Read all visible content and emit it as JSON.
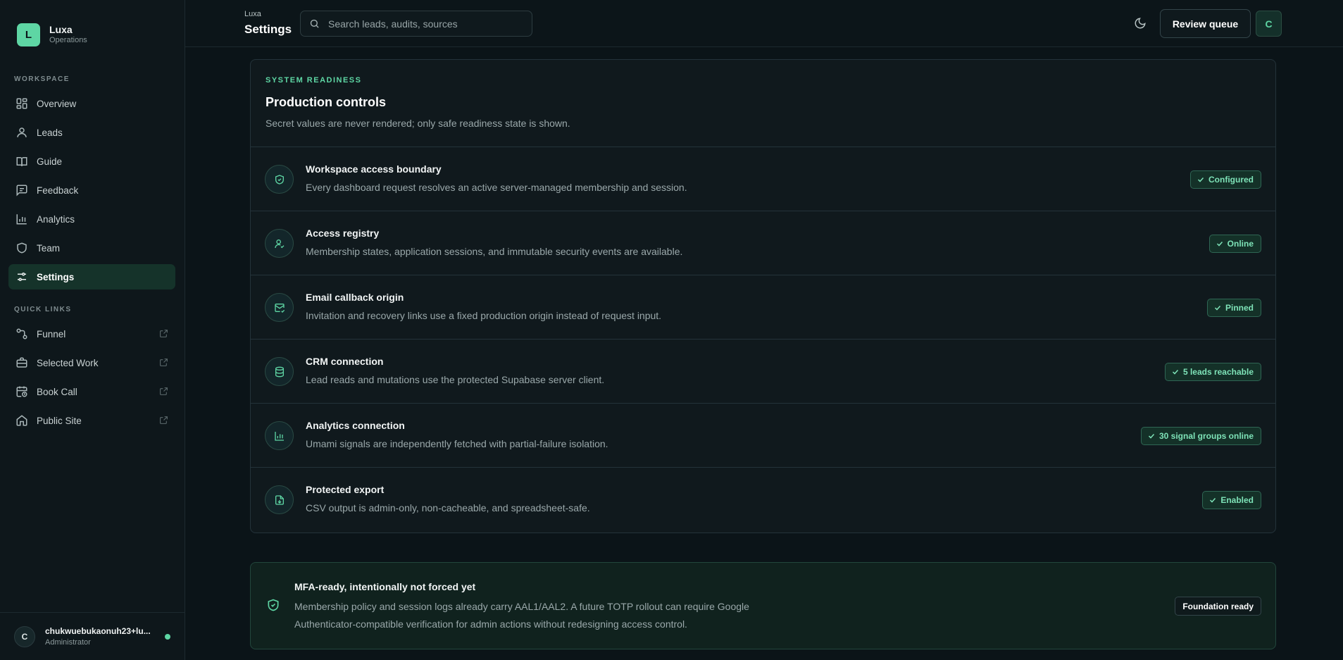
{
  "brand": {
    "logo_letter": "L",
    "name": "Luxa",
    "subtitle": "Operations"
  },
  "sidebar": {
    "workspace_label": "WORKSPACE",
    "workspace_items": [
      {
        "label": "Overview",
        "icon": "grid-icon"
      },
      {
        "label": "Leads",
        "icon": "user-icon"
      },
      {
        "label": "Guide",
        "icon": "book-open-icon"
      },
      {
        "label": "Feedback",
        "icon": "message-square-icon"
      },
      {
        "label": "Analytics",
        "icon": "bar-chart-icon"
      },
      {
        "label": "Team",
        "icon": "shield-icon"
      },
      {
        "label": "Settings",
        "icon": "sliders-icon",
        "active": true
      }
    ],
    "quick_links_label": "QUICK LINKS",
    "quick_links": [
      {
        "label": "Funnel",
        "icon": "funnel-icon"
      },
      {
        "label": "Selected Work",
        "icon": "briefcase-icon"
      },
      {
        "label": "Book Call",
        "icon": "calendar-clock-icon"
      },
      {
        "label": "Public Site",
        "icon": "home-icon"
      }
    ],
    "user": {
      "avatar_letter": "C",
      "email": "chukwuebukaonuh23+lu...",
      "role": "Administrator",
      "status_color": "#5ed6a4"
    }
  },
  "header": {
    "breadcrumb": "Luxa",
    "title": "Settings",
    "search_placeholder": "Search leads, audits, sources",
    "review_button": "Review queue",
    "avatar_letter": "C"
  },
  "readiness": {
    "eyebrow": "SYSTEM READINESS",
    "title": "Production controls",
    "description": "Secret values are never rendered; only safe readiness state is shown.",
    "rows": [
      {
        "title": "Workspace access boundary",
        "description": "Every dashboard request resolves an active server-managed membership and session.",
        "badge": "Configured",
        "icon": "shield-check-icon"
      },
      {
        "title": "Access registry",
        "description": "Membership states, application sessions, and immutable security events are available.",
        "badge": "Online",
        "icon": "user-check-icon"
      },
      {
        "title": "Email callback origin",
        "description": "Invitation and recovery links use a fixed production origin instead of request input.",
        "badge": "Pinned",
        "icon": "mail-check-icon"
      },
      {
        "title": "CRM connection",
        "description": "Lead reads and mutations use the protected Supabase server client.",
        "badge": "5 leads reachable",
        "icon": "database-icon"
      },
      {
        "title": "Analytics connection",
        "description": "Umami signals are independently fetched with partial-failure isolation.",
        "badge": "30 signal groups online",
        "icon": "bar-chart-icon"
      },
      {
        "title": "Protected export",
        "description": "CSV output is admin-only, non-cacheable, and spreadsheet-safe.",
        "badge": "Enabled",
        "icon": "file-download-icon"
      }
    ]
  },
  "mfa": {
    "title": "MFA-ready, intentionally not forced yet",
    "description": "Membership policy and session logs already carry AAL1/AAL2. A future TOTP rollout can require Google Authenticator-compatible verification for admin actions without redesigning access control.",
    "badge": "Foundation ready"
  },
  "colors": {
    "accent": "#5ed6a4",
    "background": "#0b1418",
    "surface": "#10191d"
  }
}
